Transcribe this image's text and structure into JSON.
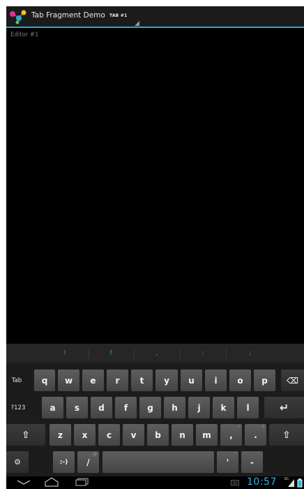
{
  "action_bar": {
    "title": "Tab Fragment Demo",
    "tab_label": "TAB #1"
  },
  "editor": {
    "placeholder": "Editor #1"
  },
  "keyboard": {
    "suggestions": [
      "!",
      "?",
      ",",
      ":",
      ";"
    ],
    "row1": [
      "Tab",
      "q",
      "w",
      "e",
      "r",
      "t",
      "y",
      "u",
      "i",
      "o",
      "p"
    ],
    "row2": [
      "?123",
      "a",
      "s",
      "d",
      "f",
      "g",
      "h",
      "j",
      "k",
      "l"
    ],
    "row3": [
      "z",
      "x",
      "c",
      "v",
      "b",
      "n",
      "m",
      ",",
      "."
    ],
    "row3_hints": [
      "!",
      "?"
    ],
    "row4": [
      ":-)",
      "/",
      "'",
      "-"
    ],
    "row4_hints": [
      "@",
      "\""
    ],
    "settings_glyph": "⚙",
    "backspace_glyph": "⌫",
    "enter_glyph": "↵",
    "shift_glyph": "⇧"
  },
  "status_bar": {
    "clock": "10:57",
    "network": "3G"
  },
  "colors": {
    "accent": "#33b5e5",
    "action_bar_bg": "#1b1b1b",
    "key_bg": "#4f4f4f"
  }
}
